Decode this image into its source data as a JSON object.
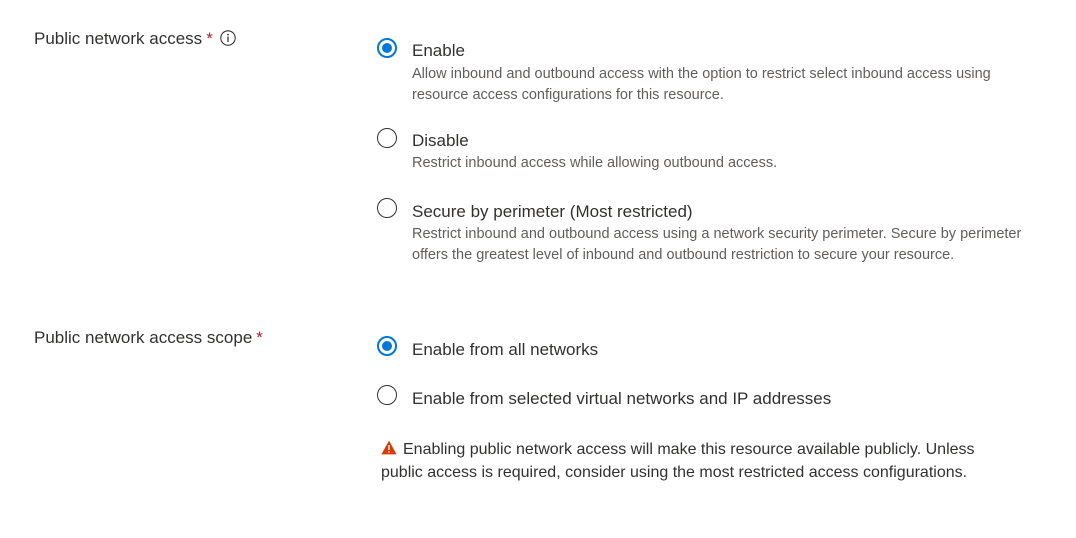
{
  "public_network_access": {
    "label": "Public network access",
    "required_marker": "*",
    "info_icon": "info-icon",
    "options": [
      {
        "label": "Enable",
        "description": "Allow inbound and outbound access with the option to restrict select inbound access using resource access configurations for this resource.",
        "selected": true
      },
      {
        "label": "Disable",
        "description": "Restrict inbound access while allowing outbound access.",
        "selected": false
      },
      {
        "label": "Secure by perimeter (Most restricted)",
        "description": "Restrict inbound and outbound access using a network security perimeter. Secure by perimeter offers the greatest level of inbound and outbound restriction to secure your resource.",
        "selected": false
      }
    ]
  },
  "public_network_access_scope": {
    "label": "Public network access scope",
    "required_marker": "*",
    "options": [
      {
        "label": "Enable from all networks",
        "selected": true
      },
      {
        "label": "Enable from selected virtual networks and IP addresses",
        "selected": false
      }
    ]
  },
  "warning": {
    "icon": "warning-icon",
    "icon_color": "#d83b01",
    "text": "Enabling public network access will make this resource available publicly. Unless public access is required, consider using the most restricted access configurations."
  },
  "colors": {
    "accent": "#0078d4",
    "required": "#a4262c",
    "text": "#323130",
    "secondary_text": "#605e5c"
  }
}
